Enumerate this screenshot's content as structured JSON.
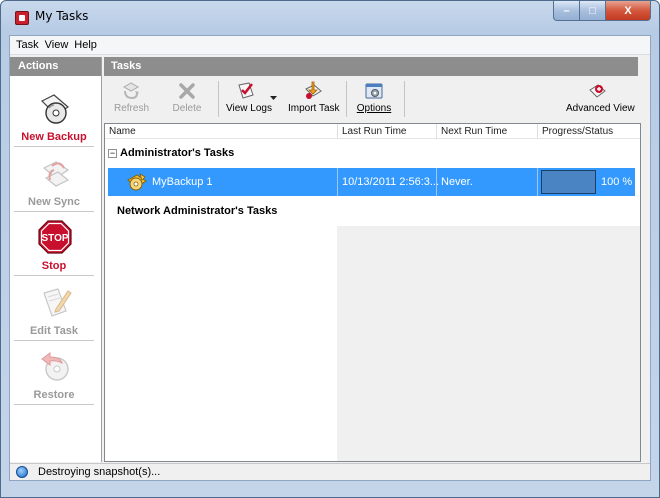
{
  "window": {
    "title": "My Tasks"
  },
  "caption_buttons": {
    "minimize": "–",
    "maximize": "□",
    "close": "X"
  },
  "menu": [
    "Task",
    "View",
    "Help"
  ],
  "actions": {
    "header": "Actions",
    "items": [
      {
        "label": "New Backup",
        "icon": "cd-backup-icon",
        "enabled": true
      },
      {
        "label": "New Sync",
        "icon": "sync-icon",
        "enabled": false
      },
      {
        "label": "Stop",
        "icon": "stop-sign-icon",
        "enabled": true,
        "sign_text": "STOP"
      },
      {
        "label": "Edit Task",
        "icon": "edit-task-icon",
        "enabled": false
      },
      {
        "label": "Restore",
        "icon": "restore-icon",
        "enabled": false
      }
    ]
  },
  "tasks": {
    "header": "Tasks",
    "toolbar": {
      "refresh": "Refresh",
      "delete": "Delete",
      "view_logs": "View Logs",
      "import_task": "Import Task",
      "options": "Options",
      "advanced_view": "Advanced View"
    },
    "columns": [
      "Name",
      "Last Run Time",
      "Next Run Time",
      "Progress/Status"
    ],
    "groups": [
      {
        "name": "Administrator's Tasks",
        "expander": "−"
      },
      {
        "name": "Network Administrator's Tasks"
      }
    ],
    "rows": [
      {
        "name": "MyBackup 1",
        "last_run": "10/13/2011 2:56:3...",
        "next_run": "Never.",
        "progress": "100 %",
        "progress_value": 1.0
      }
    ]
  },
  "status": {
    "text": "Destroying snapshot(s)..."
  },
  "colors": {
    "selection": "#3399ff",
    "accent_red": "#c8102e",
    "header_gray": "#8d8d8d"
  }
}
